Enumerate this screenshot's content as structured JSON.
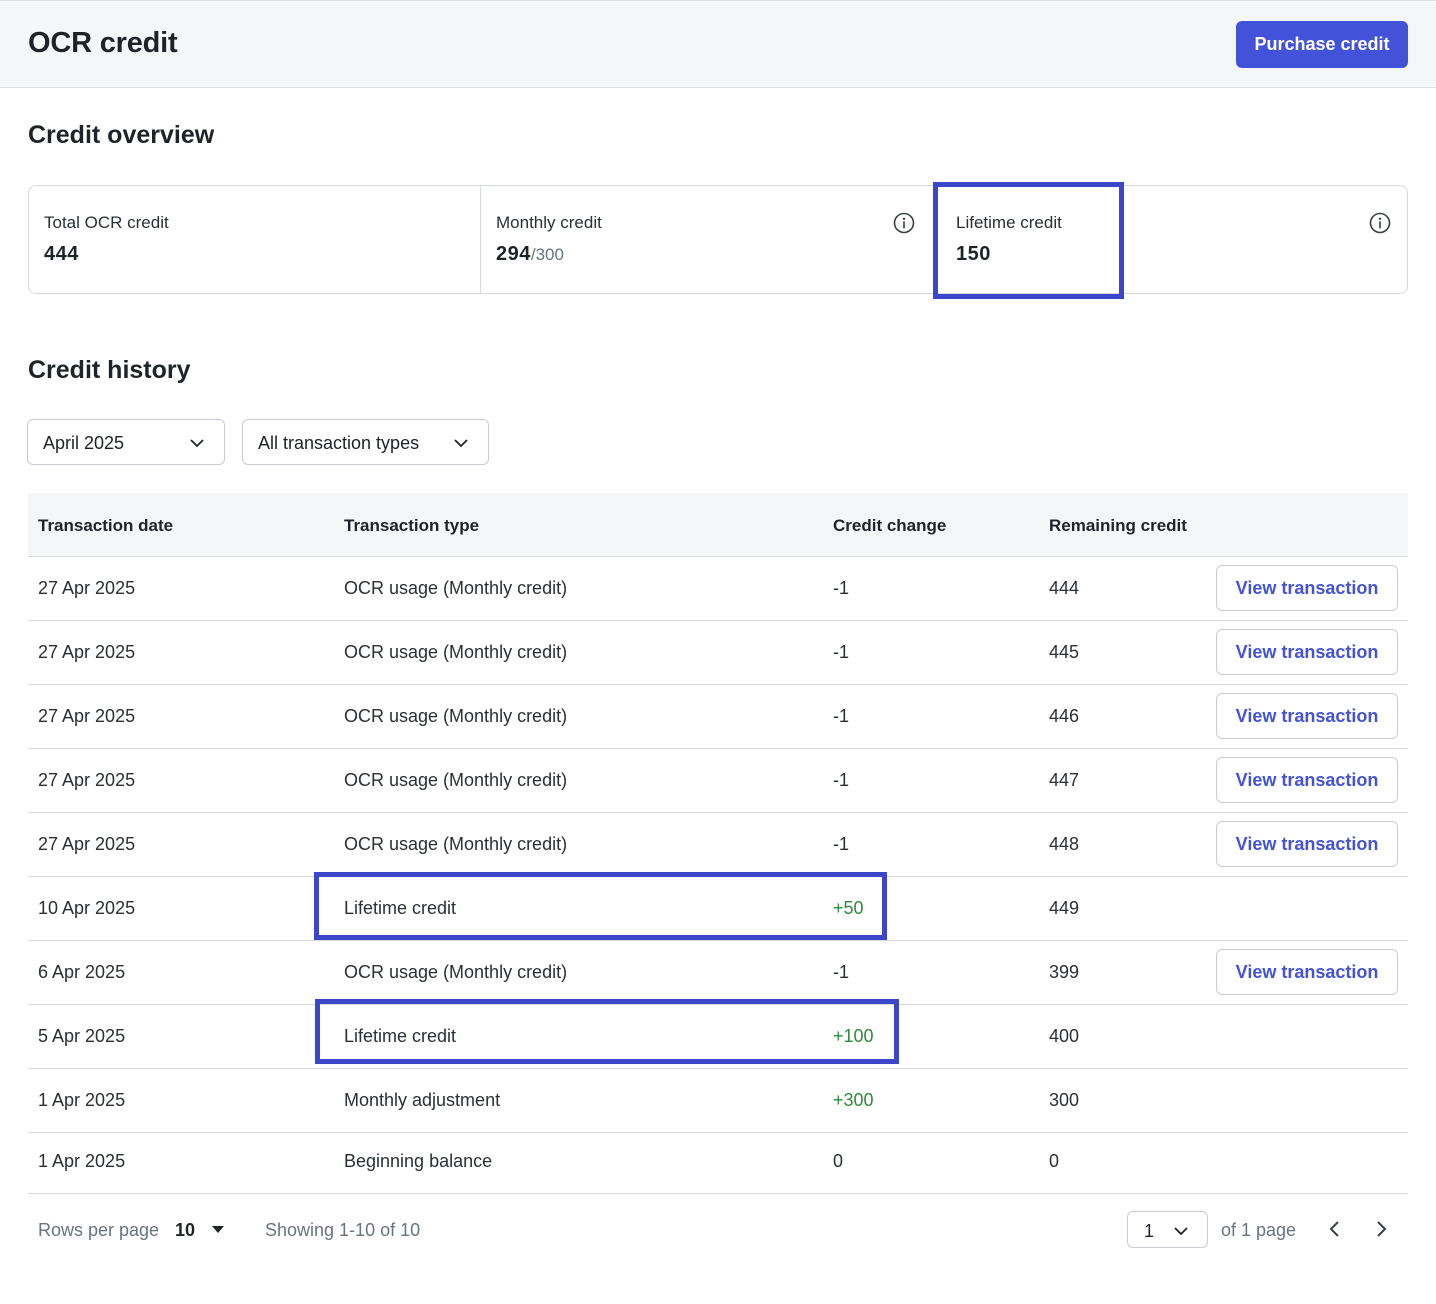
{
  "header": {
    "title": "OCR credit",
    "purchase_button": "Purchase credit"
  },
  "overview": {
    "title": "Credit overview",
    "total": {
      "label": "Total OCR credit",
      "value": "444"
    },
    "monthly": {
      "label": "Monthly credit",
      "value": "294",
      "max": "/300"
    },
    "lifetime": {
      "label": "Lifetime credit",
      "value": "150"
    }
  },
  "history": {
    "title": "Credit history",
    "month_filter": "April 2025",
    "type_filter": "All transaction types",
    "columns": [
      "Transaction date",
      "Transaction type",
      "Credit change",
      "Remaining credit"
    ],
    "view_label": "View transaction",
    "rows": [
      {
        "date": "27 Apr 2025",
        "type": "OCR usage (Monthly credit)",
        "change": "-1",
        "remaining": "444",
        "has_view": true
      },
      {
        "date": "27 Apr 2025",
        "type": "OCR usage (Monthly credit)",
        "change": "-1",
        "remaining": "445",
        "has_view": true
      },
      {
        "date": "27 Apr 2025",
        "type": "OCR usage (Monthly credit)",
        "change": "-1",
        "remaining": "446",
        "has_view": true
      },
      {
        "date": "27 Apr 2025",
        "type": "OCR usage (Monthly credit)",
        "change": "-1",
        "remaining": "447",
        "has_view": true
      },
      {
        "date": "27 Apr 2025",
        "type": "OCR usage (Monthly credit)",
        "change": "-1",
        "remaining": "448",
        "has_view": true
      },
      {
        "date": "10 Apr 2025",
        "type": "Lifetime credit",
        "change": "+50",
        "remaining": "449",
        "has_view": false
      },
      {
        "date": "6 Apr 2025",
        "type": "OCR usage (Monthly credit)",
        "change": "-1",
        "remaining": "399",
        "has_view": true
      },
      {
        "date": "5 Apr 2025",
        "type": "Lifetime credit",
        "change": "+100",
        "remaining": "400",
        "has_view": false
      },
      {
        "date": "1 Apr 2025",
        "type": "Monthly adjustment",
        "change": "+300",
        "remaining": "300",
        "has_view": false
      },
      {
        "date": "1 Apr 2025",
        "type": "Beginning balance",
        "change": "0",
        "remaining": "0",
        "has_view": false
      }
    ]
  },
  "pagination": {
    "rows_per_page_label": "Rows per page",
    "rows_per_page_value": "10",
    "showing": "Showing 1-10 of 10",
    "page_value": "1",
    "of_pages": "of 1 page"
  },
  "colors": {
    "accent": "#4353d9",
    "highlight_box": "#3b46c9",
    "positive": "#2f8a3e"
  }
}
